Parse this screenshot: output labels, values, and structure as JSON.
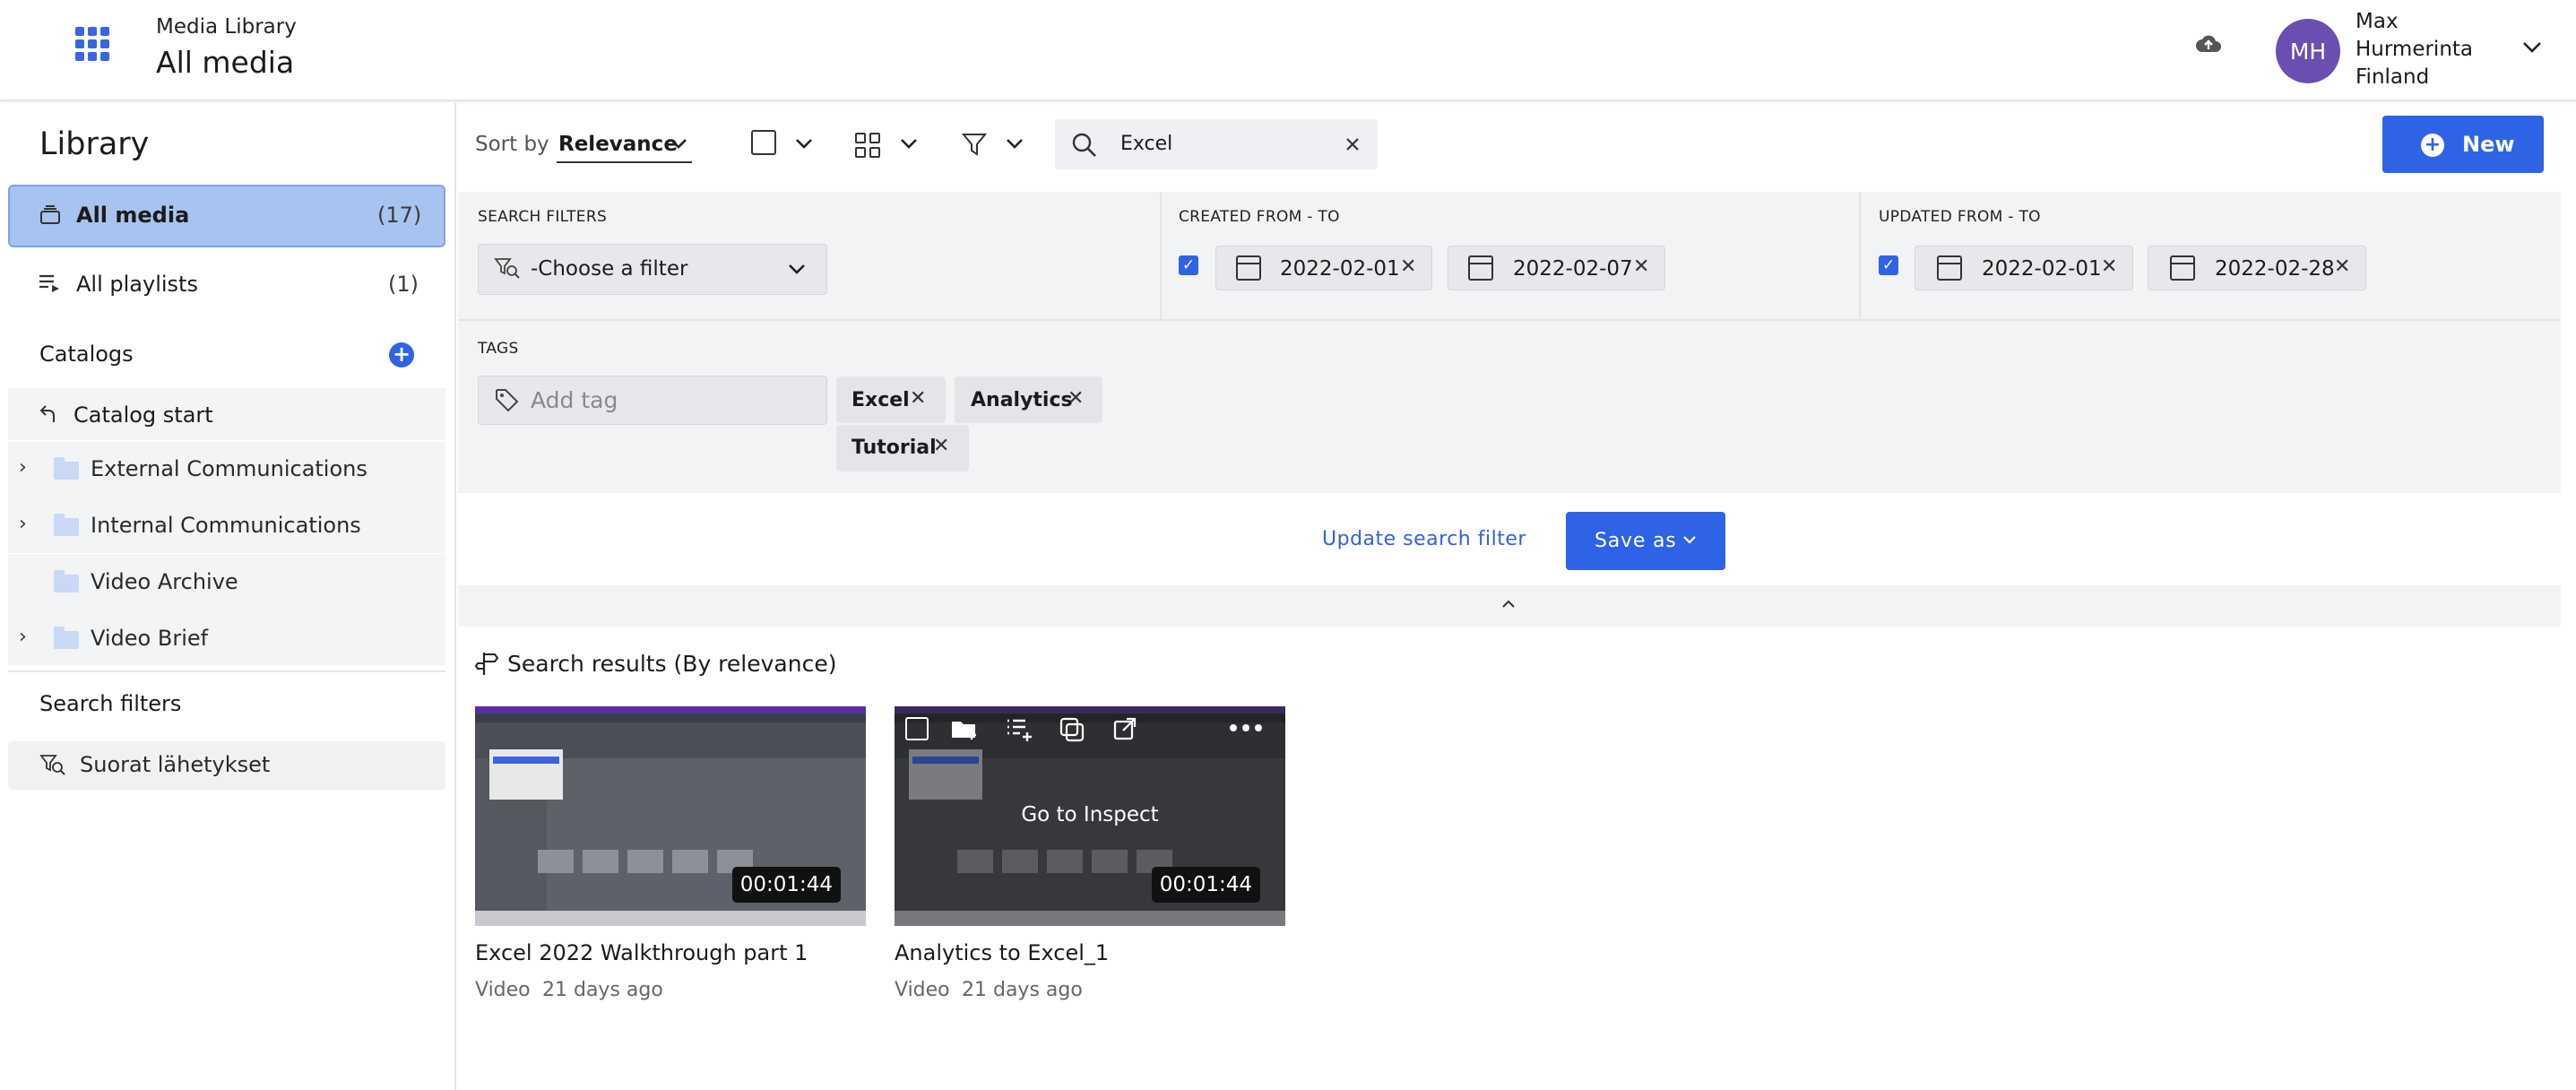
{
  "header": {
    "subtitle": "Media Library",
    "title": "All media",
    "user": {
      "initials": "MH",
      "name_line1": "Max",
      "name_line2": "Hurmerinta",
      "name_line3": "Finland"
    }
  },
  "sidebar": {
    "title": "Library",
    "nav": [
      {
        "label": "All media",
        "count": "(17)",
        "active": true
      },
      {
        "label": "All playlists",
        "count": "(1)",
        "active": false
      }
    ],
    "catalogs_label": "Catalogs",
    "catalog_start": "Catalog start",
    "folders": [
      {
        "label": "External Communications",
        "expandable": true
      },
      {
        "label": "Internal Communications",
        "expandable": true
      },
      {
        "label": "Video Archive",
        "expandable": false
      },
      {
        "label": "Video Brief",
        "expandable": true
      }
    ],
    "search_filters_label": "Search filters",
    "saved_filters": [
      {
        "label": "Suorat lähetykset"
      }
    ]
  },
  "toolbar": {
    "sort_label": "Sort by",
    "sort_value": "Relevance",
    "search_value": "Excel",
    "new_label": "New"
  },
  "filters": {
    "search_filters_header": "SEARCH FILTERS",
    "choose_filter": "-Choose a filter",
    "created_header": "CREATED FROM - TO",
    "created_from": "2022-02-01",
    "created_to": "2022-02-07",
    "updated_header": "UPDATED FROM - TO",
    "updated_from": "2022-02-01",
    "updated_to": "2022-02-28",
    "tags_header": "TAGS",
    "tag_placeholder": "Add tag",
    "tags": [
      "Excel",
      "Analytics",
      "Tutorial"
    ],
    "update_link": "Update search filter",
    "save_as": "Save as"
  },
  "results": {
    "title": "Search results (By relevance)",
    "items": [
      {
        "title": "Excel 2022 Walkthrough part 1",
        "type": "Video",
        "age": "21 days ago",
        "duration": "00:01:44"
      },
      {
        "title": "Analytics to Excel_1",
        "type": "Video",
        "age": "21 days ago",
        "duration": "00:01:44",
        "hover_text": "Go to Inspect"
      }
    ]
  },
  "colors": {
    "accent": "#2f63e6",
    "active_nav": "#a7c3ef",
    "avatar": "#6a4fb0",
    "panel_bg": "#f2f3f5"
  }
}
